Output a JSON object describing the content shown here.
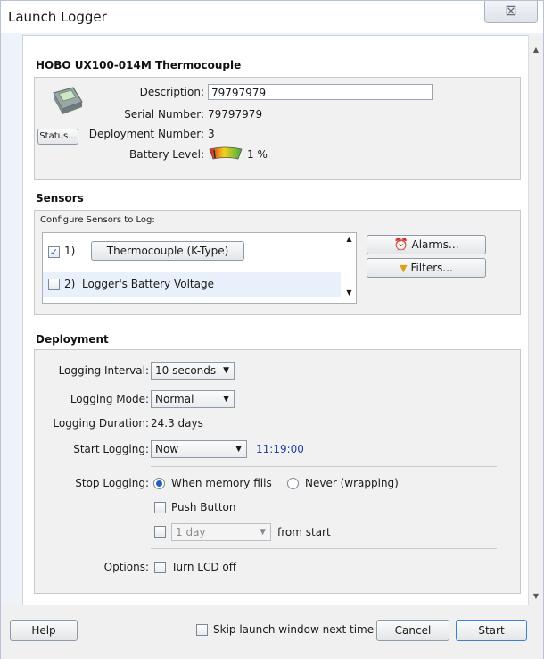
{
  "window": {
    "title": "Launch Logger",
    "close_glyph": "⊠"
  },
  "device": {
    "heading": "HOBO UX100-014M Thermocouple",
    "status_button": "Status...",
    "description_label": "Description:",
    "description_value": "79797979",
    "serial_label": "Serial Number:",
    "serial_value": "79797979",
    "deployment_number_label": "Deployment Number:",
    "deployment_number_value": "3",
    "battery_label": "Battery Level:",
    "battery_value": "1 %",
    "battery_level": 0.01
  },
  "sensors": {
    "heading": "Sensors",
    "configure_label": "Configure Sensors to Log:",
    "items": [
      {
        "number": "1)",
        "label": "Thermocouple (K-Type)",
        "checked": true
      },
      {
        "number": "2)",
        "label": "Logger's Battery Voltage",
        "checked": false
      }
    ],
    "alarms_button": "Alarms...",
    "filters_button": "Filters..."
  },
  "deployment": {
    "heading": "Deployment",
    "logging_interval_label": "Logging Interval:",
    "logging_interval_value": "10 seconds",
    "logging_mode_label": "Logging Mode:",
    "logging_mode_value": "Normal",
    "logging_duration_label": "Logging Duration:",
    "logging_duration_value": "24.3 days",
    "start_logging_label": "Start Logging:",
    "start_logging_value": "Now",
    "start_time": "11:19:00",
    "stop_logging_label": "Stop Logging:",
    "stop_option_memory": "When memory fills",
    "stop_option_never": "Never (wrapping)",
    "push_button_label": "Push Button",
    "after_duration_value": "1 day",
    "from_start_label": "from start",
    "options_label": "Options:",
    "lcd_off_label": "Turn LCD off"
  },
  "footer": {
    "help_button": "Help",
    "skip_label": "Skip launch window next time",
    "cancel_button": "Cancel",
    "start_button": "Start"
  },
  "colors": {
    "accent": "#1f5fbf",
    "time_text": "#1f3fa8",
    "window_border": "#b7c3d3"
  }
}
